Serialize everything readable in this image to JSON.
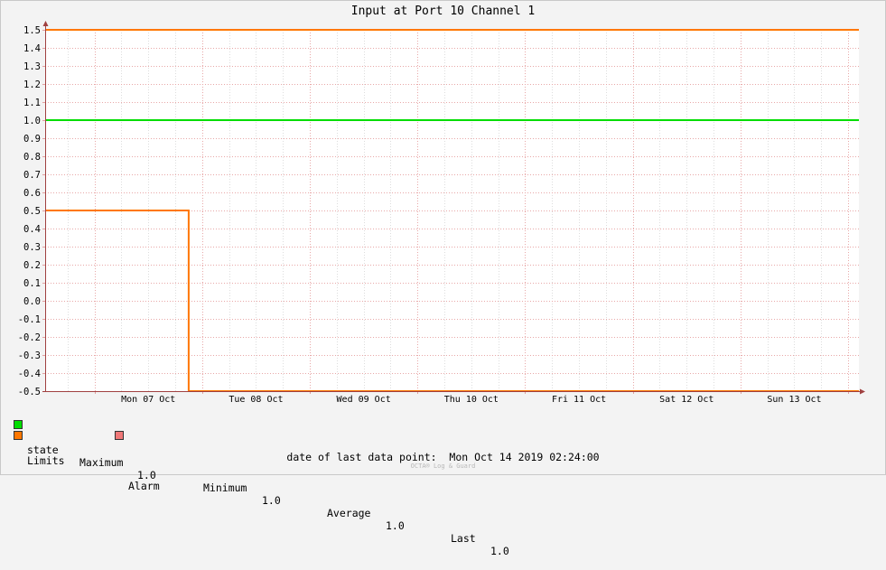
{
  "chart_data": {
    "type": "line",
    "title": "Input at Port 10 Channel 1",
    "xlabel": "",
    "ylabel": "",
    "x_tick_labels": [
      "Mon 07 Oct",
      "Tue 08 Oct",
      "Wed 09 Oct",
      "Thu 10 Oct",
      "Fri 11 Oct",
      "Sat 12 Oct",
      "Sun 13 Oct"
    ],
    "xlim": [
      "2019-10-06 13:00",
      "2019-10-14 02:24"
    ],
    "ylim": [
      -0.5,
      1.5
    ],
    "y_ticks": [
      1.5,
      1.4,
      1.3,
      1.2,
      1.1,
      1.0,
      0.9,
      0.8,
      0.7,
      0.6,
      0.5,
      0.4,
      0.3,
      0.2,
      0.1,
      0.0,
      -0.1,
      -0.2,
      -0.3,
      -0.4,
      -0.5
    ],
    "y_tick_labels": [
      "1.5",
      "1.4",
      "1.3",
      "1.2",
      "1.1",
      "1.0",
      "0.9",
      "0.8",
      "0.7",
      "0.6",
      "0.5",
      "0.4",
      "0.3",
      "0.2",
      "0.1",
      "0.0",
      "-0.1",
      "-0.2",
      "-0.3",
      "-0.4",
      "-0.5"
    ],
    "grid": true,
    "series": [
      {
        "name": "state",
        "color": "#00dd00",
        "points": [
          [
            "2019-10-06 13:00",
            1.0
          ],
          [
            "2019-10-14 02:24",
            1.0
          ]
        ]
      },
      {
        "name": "Limits",
        "color": "#ff7700",
        "points": [
          [
            "2019-10-06 13:00",
            1.5
          ],
          [
            "2019-10-14 02:24",
            1.5
          ]
        ]
      },
      {
        "name": "Limits",
        "color": "#ff7700",
        "points": [
          [
            "2019-10-06 13:00",
            0.5
          ],
          [
            "2019-10-07 21:00",
            0.5
          ],
          [
            "2019-10-07 21:00",
            -0.5
          ],
          [
            "2019-10-14 02:24",
            -0.5
          ]
        ]
      }
    ]
  },
  "legend": {
    "state_label": "state",
    "state_color": "#00dd00",
    "max_label": "Maximum",
    "max_value": "1.0",
    "min_label": "Minimum",
    "min_value": "1.0",
    "avg_label": "Average",
    "avg_value": "1.0",
    "last_label": "Last",
    "last_value": "1.0",
    "limits_label": "Limits",
    "limits_color": "#ff7700",
    "alarm_label": "Alarm",
    "alarm_color": "#f07878"
  },
  "footer": {
    "last_point_label": "date of last data point:",
    "last_point_value": "Mon Oct 14 2019 02:24:00",
    "watermark": "OCTA® Log & Guard"
  }
}
